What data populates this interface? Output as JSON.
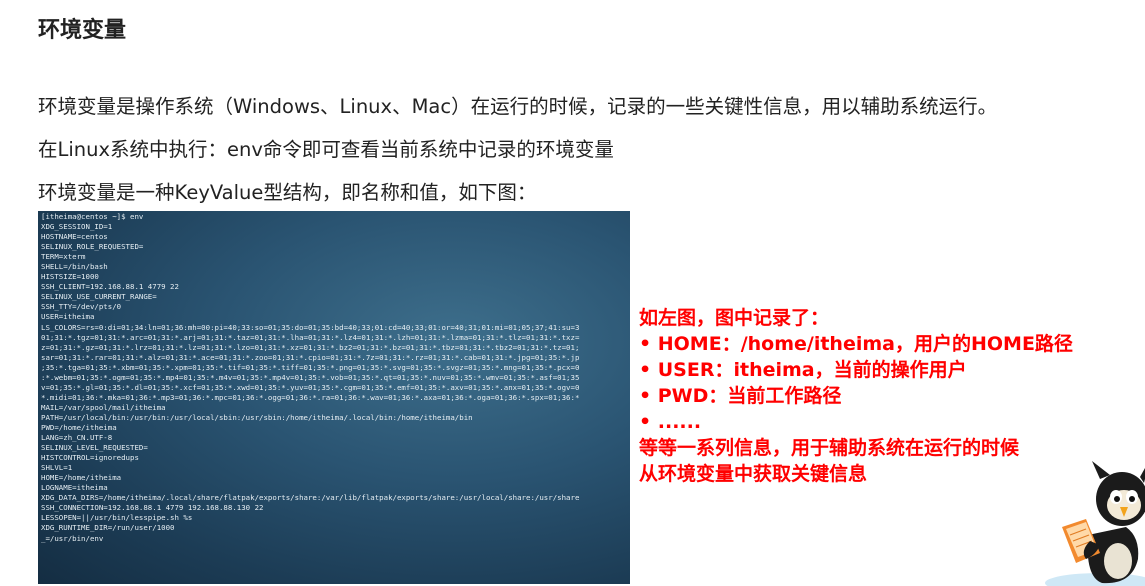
{
  "title": "环境变量",
  "paragraphs": [
    "环境变量是操作系统（Windows、Linux、Mac）在运行的时候，记录的一些关键性信息，用以辅助系统运行。",
    "在Linux系统中执行：env命令即可查看当前系统中记录的环境变量",
    "环境变量是一种KeyValue型结构，即名称和值，如下图："
  ],
  "terminal": {
    "lines": [
      "[itheima@centos ~]$ env",
      "XDG_SESSION_ID=1",
      "HOSTNAME=centos",
      "SELINUX_ROLE_REQUESTED=",
      "TERM=xterm",
      "SHELL=/bin/bash",
      "HISTSIZE=1000",
      "SSH_CLIENT=192.168.88.1 4779 22",
      "SELINUX_USE_CURRENT_RANGE=",
      "SSH_TTY=/dev/pts/0",
      "USER=itheima",
      "LS_COLORS=rs=0:di=01;34:ln=01;36:mh=00:pi=40;33:so=01;35:do=01;35:bd=40;33;01:cd=40;33;01:or=40;31;01:mi=01;05;37;41:su=3",
      "01;31:*.tgz=01;31:*.arc=01;31:*.arj=01;31:*.taz=01;31:*.lha=01;31:*.lz4=01;31:*.lzh=01;31:*.lzma=01;31:*.tlz=01;31:*.txz=",
      "z=01;31:*.gz=01;31:*.lrz=01;31:*.lz=01;31:*.lzo=01;31:*.xz=01;31:*.bz2=01;31:*.bz=01;31:*.tbz=01;31:*.tbz2=01;31:*.tz=01;",
      "sar=01;31:*.rar=01;31:*.alz=01;31:*.ace=01;31:*.zoo=01;31:*.cpio=01;31:*.7z=01;31:*.rz=01;31:*.cab=01;31:*.jpg=01;35:*.jp",
      ";35:*.tga=01;35:*.xbm=01;35:*.xpm=01;35:*.tif=01;35:*.tiff=01;35:*.png=01;35:*.svg=01;35:*.svgz=01;35:*.mng=01;35:*.pcx=0",
      ":*.webm=01;35:*.ogm=01;35:*.mp4=01;35:*.m4v=01;35:*.mp4v=01;35:*.vob=01;35:*.qt=01;35:*.nuv=01;35:*.wmv=01;35:*.asf=01;35",
      "v=01;35:*.gl=01;35:*.dl=01;35:*.xcf=01;35:*.xwd=01;35:*.yuv=01;35:*.cgm=01;35:*.emf=01;35:*.axv=01;35:*.anx=01;35:*.ogv=0",
      "*.midi=01;36:*.mka=01;36:*.mp3=01;36:*.mpc=01;36:*.ogg=01;36:*.ra=01;36:*.wav=01;36:*.axa=01;36:*.oga=01;36:*.spx=01;36:*",
      "MAIL=/var/spool/mail/itheima",
      "PATH=/usr/local/bin:/usr/bin:/usr/local/sbin:/usr/sbin:/home/itheima/.local/bin:/home/itheima/bin",
      "PWD=/home/itheima",
      "LANG=zh_CN.UTF-8",
      "SELINUX_LEVEL_REQUESTED=",
      "HISTCONTROL=ignoredups",
      "SHLVL=1",
      "HOME=/home/itheima",
      "LOGNAME=itheima",
      "XDG_DATA_DIRS=/home/itheima/.local/share/flatpak/exports/share:/var/lib/flatpak/exports/share:/usr/local/share:/usr/share",
      "SSH_CONNECTION=192.168.88.1 4779 192.168.88.130 22",
      "LESSOPEN=||/usr/bin/lesspipe.sh %s",
      "XDG_RUNTIME_DIR=/run/user/1000",
      "_=/usr/bin/env"
    ]
  },
  "notes": {
    "lines": [
      "如左图，图中记录了：",
      "• HOME：/home/itheima，用户的HOME路径",
      "• USER：itheima，当前的操作用户",
      "• PWD：当前工作路径",
      "• ......",
      "等等一系列信息，用于辅助系统在运行的时候",
      "从环境变量中获取关键信息"
    ],
    "color": "#ff0000"
  },
  "terminal_colors": {
    "bg_light": "#3e6f8c",
    "bg_dark": "#142d42",
    "text": "#e6eef3"
  },
  "mascot_icon": "reading-mascot-icon"
}
